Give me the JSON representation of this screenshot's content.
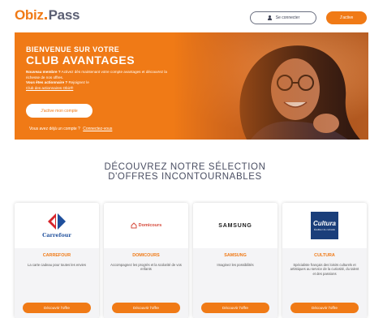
{
  "header": {
    "logo_part1": "Obiz",
    "logo_part2": "Pass",
    "login_label": "Se connecter",
    "activate_label": "J'active"
  },
  "hero": {
    "title_line1": "BIENVENUE SUR VOTRE",
    "title_line2": "CLUB AVANTAGES",
    "new_member_bold": "Nouveau membre ?",
    "new_member_text": "Activez dès maintenant votre compte avantages et découvrez la richesse de nos offres.",
    "shareholder_bold": "Vous êtes actionnaire ?",
    "shareholder_text": "Rejoignez le",
    "shareholder_link": "Club des actionnaires Obiz®",
    "activate_button": "J'active mon compte",
    "account_question": "Vous avez déjà un compte ?",
    "account_link": "Connectez-vous"
  },
  "section": {
    "title_line1": "DÉCOUVREZ NOTRE SÉLECTION",
    "title_line2": "D'OFFRES INCONTOURNABLES"
  },
  "cards": [
    {
      "logo_text": "Carrefour",
      "name": "CARREFOUR",
      "desc": "La carte cadeau pour toutes les envies",
      "button": "Découvrir l'offre"
    },
    {
      "logo_text": "Domicours",
      "name": "DOMICOURS",
      "desc": "Accompagnez les progrès et la scolarité de vos enfants",
      "button": "Découvrir l'offre"
    },
    {
      "logo_text": "SAMSUNG",
      "name": "SAMSUNG",
      "desc": "Imaginez les possibilités",
      "button": "Découvrir l'offre"
    },
    {
      "logo_text": "Cultura",
      "logo_subtext": "Éveilleur de curiosité",
      "name": "CULTURA",
      "desc": "Spécialiste français des loisirs culturels et artistiques au service de la curiosité, du talent et des passions",
      "button": "Découvrir l'offre"
    }
  ],
  "colors": {
    "brand_orange": "#f07a16",
    "brand_gray": "#5b5f73",
    "cultura_blue": "#1a3e7a"
  }
}
